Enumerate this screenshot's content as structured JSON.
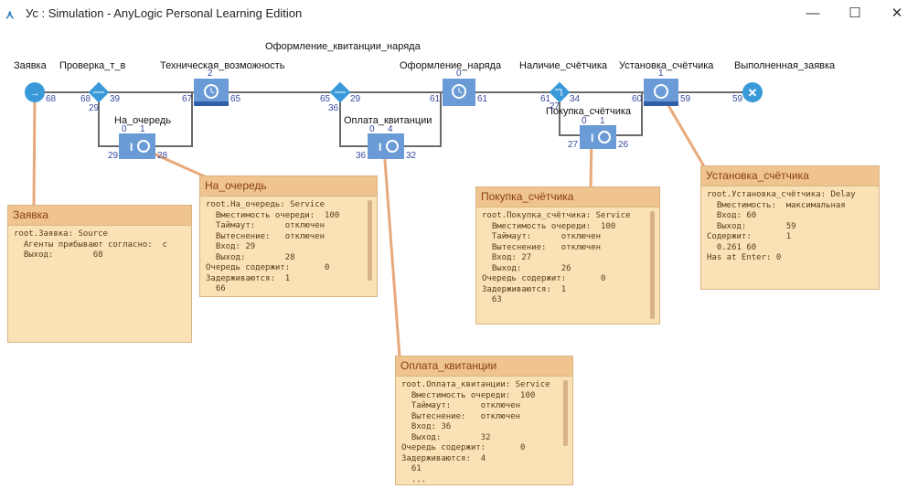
{
  "window": {
    "title": "Ус : Simulation - AnyLogic Personal Learning Edition",
    "minimize": "—",
    "maximize": "☐",
    "close": "✕"
  },
  "blocks": {
    "source": "Заявка",
    "select1": "Проверка_т_в",
    "delay1": "Техническая_возможность",
    "select2": "Оформление_квитанции_наряда",
    "delay2": "Оформление_наряда",
    "select3": "Наличие_счётчика",
    "delay3": "Установка_счётчика",
    "sink": "Выполненная_заявка",
    "service1": "На_очередь",
    "service2": "Оплата_квитанции",
    "service3": "Покупка_счётчика"
  },
  "counts": {
    "source_out": "68",
    "s1_in": "68",
    "s1_out": "39",
    "s1_alt": "29",
    "d1_cnt": "2",
    "d1_in": "67",
    "d1_out": "65",
    "sv1_q": "0",
    "sv1_d": "1",
    "sv1_in": "29",
    "sv1_out": "28",
    "s2_in": "65",
    "s2_out": "29",
    "s2_alt": "36",
    "sv2_q": "0",
    "sv2_d": "4",
    "sv2_in": "36",
    "sv2_out": "32",
    "d2_cnt": "0",
    "d2_in": "61",
    "d2_out": "61",
    "s3_in": "61",
    "s3_out": "34",
    "s3_alt": "27",
    "sv3_q": "0",
    "sv3_d": "1",
    "sv3_in": "27",
    "sv3_out": "26",
    "d3_cnt": "1",
    "d3_in": "60",
    "d3_out": "59",
    "sink_in": "59"
  },
  "callouts": {
    "source": {
      "title": "Заявка",
      "body": "root.Заявка: Source\n  Агенты прибывают согласно:  с\n  Выход:        68"
    },
    "service1": {
      "title": "На_очередь",
      "body": "root.На_очередь: Service\n  Вместимость очереди:  100\n  Таймаут:      отключен\n  Вытеснение:   отключен\n  Вход: 29\n  Выход:        28\nОчередь содержит:       0\nЗадерживаются:  1\n  66"
    },
    "service3": {
      "title": "Покупка_счётчика",
      "body": "root.Покупка_счётчика: Service\n  Вместимость очереди:  100\n  Таймаут:      отключен\n  Вытеснение:   отключен\n  Вход: 27\n  Выход:        26\nОчередь содержит:       0\nЗадерживаются:  1\n  63"
    },
    "delay3": {
      "title": "Установка_счётчика",
      "body": "root.Установка_счётчика: Delay\n  Вместимость:  максимальная\n  Вход: 60\n  Выход:        59\nСодержит:       1\n  0.261 60\nHas at Enter: 0"
    },
    "service2": {
      "title": "Оплата_квитанции",
      "body": "root.Оплата_квитанции: Service\n  Вместимость очереди:  100\n  Таймаут:      отключен\n  Вытеснение:   отключен\n  Вход: 36\n  Выход:        32\nОчередь содержит:       0\nЗадерживаются:  4\n  61\n  ..."
    }
  },
  "colors": {
    "block": "#5b8fd0",
    "node": "#3a9ad9",
    "callout": "#fbe2b6",
    "callout_header": "#efc48e",
    "connector": "#e9a97a"
  }
}
